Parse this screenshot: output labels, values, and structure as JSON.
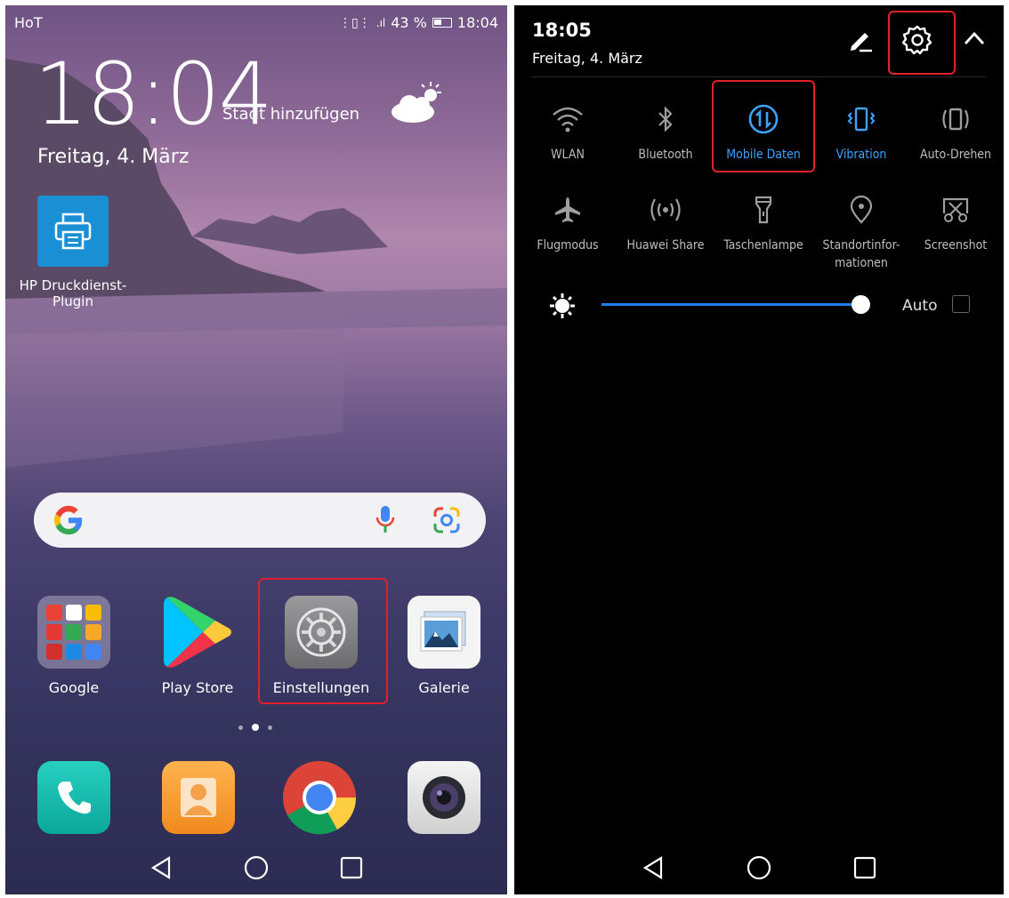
{
  "home": {
    "status": {
      "carrier": "HoT",
      "battery": "43 %",
      "time": "18:04"
    },
    "clock": "18:04",
    "weather_city": "Stadt hinzufügen",
    "date": "Freitag, 4. März",
    "apps": [
      {
        "label": "HP Druckdienst-Plugin"
      }
    ],
    "dock": [
      {
        "label": "Google"
      },
      {
        "label": "Play Store"
      },
      {
        "label": "Einstellungen"
      },
      {
        "label": "Galerie"
      }
    ]
  },
  "shade": {
    "time": "18:05",
    "date": "Freitag, 4. März",
    "tiles": [
      {
        "label": "WLAN",
        "active": false
      },
      {
        "label": "Bluetooth",
        "active": false
      },
      {
        "label": "Mobile Daten",
        "active": true
      },
      {
        "label": "Vibration",
        "active": true
      },
      {
        "label": "Auto-Drehen",
        "active": false
      },
      {
        "label": "Flugmodus",
        "active": false
      },
      {
        "label": "Huawei Share",
        "active": false
      },
      {
        "label": "Taschenlampe",
        "active": false
      },
      {
        "label": "Standortinfor-\nmationen",
        "active": false
      },
      {
        "label": "Screenshot",
        "active": false
      }
    ],
    "brightness": {
      "level": 0.97,
      "auto_label": "Auto",
      "auto_checked": false
    }
  },
  "colors": {
    "highlight": "#e0202a",
    "active_blue": "#3ea2ff",
    "slider_blue": "#1e7ff0"
  }
}
